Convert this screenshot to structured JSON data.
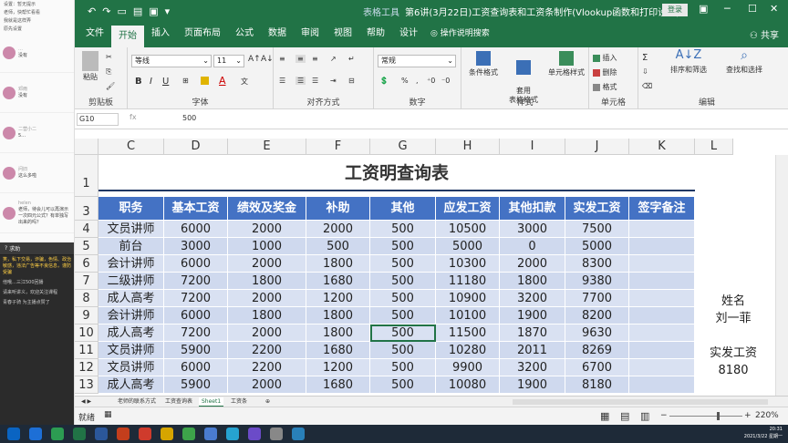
{
  "chat": {
    "top_lines": [
      "设置：暂无提示",
      "老师，快帮忙看看",
      "我就是这样弄",
      "原先设置"
    ],
    "rows": [
      {
        "name": "…",
        "text": "没有"
      },
      {
        "name": "邓雨",
        "text": "没有"
      },
      {
        "name": "二营小二",
        "text": "5…"
      },
      {
        "name": "问旧",
        "text": "这么多啦"
      },
      {
        "name": "helen",
        "text": "老师，待会儿可以再演示一次四元公式？有单独写出来的吗？"
      }
    ],
    "dark_title": "求助",
    "dark_messages": [
      {
        "text": "笑，私下交易，诈骗，色情、政治敏感，违法广告等不良信息，谨防受骗",
        "style": "y"
      },
      {
        "text": "他哦…三江500回播",
        "style": "w"
      },
      {
        "text": "请来听讲义，欢迎关注课程",
        "style": "w"
      },
      {
        "text": "青春子骑  为主播点赞了",
        "style": "w"
      }
    ]
  },
  "window": {
    "doc_title": "第6讲(3月22日)工资查询表和工资条制作(Vlookup函数和打印设置)...",
    "tool_label": "表格工具",
    "login_label": "登录",
    "share_label": "共享"
  },
  "tabs": [
    "文件",
    "开始",
    "插入",
    "页面布局",
    "公式",
    "数据",
    "审阅",
    "视图",
    "帮助",
    "设计"
  ],
  "active_tab": "开始",
  "tellme": "操作说明搜索",
  "ribbon": {
    "clipboard_label": "剪贴板",
    "paste_label": "粘贴",
    "font_name": "等线",
    "font_size": "11",
    "font_label": "字体",
    "align_label": "对齐方式",
    "number_format": "常规",
    "number_label": "数字",
    "style_items": [
      "条件格式",
      "套用\n表格格式",
      "单元格样式"
    ],
    "style_label": "样式",
    "cells_items": [
      "插入",
      "删除",
      "格式"
    ],
    "cells_label": "单元格",
    "edit_items": [
      "排序和筛选",
      "查找和选择"
    ],
    "edit_label": "编辑",
    "bold": "B",
    "italic": "I",
    "underline": "U"
  },
  "formula": {
    "namebox": "G10",
    "value": "500",
    "fx": "fx"
  },
  "columns": [
    "C",
    "D",
    "E",
    "F",
    "G",
    "H",
    "I",
    "J",
    "K",
    "L"
  ],
  "table": {
    "title": "工资明查询表",
    "headers": [
      "职务",
      "基本工资",
      "绩效及奖金",
      "补助",
      "其他",
      "应发工资",
      "其他扣款",
      "实发工资",
      "签字备注"
    ],
    "rows": [
      {
        "n": "4",
        "c": [
          "文员讲师",
          "6000",
          "2000",
          "2000",
          "500",
          "10500",
          "3000",
          "7500",
          ""
        ]
      },
      {
        "n": "5",
        "c": [
          "前台",
          "3000",
          "1000",
          "500",
          "500",
          "5000",
          "0",
          "5000",
          ""
        ]
      },
      {
        "n": "6",
        "c": [
          "会计讲师",
          "6000",
          "2000",
          "1800",
          "500",
          "10300",
          "2000",
          "8300",
          ""
        ]
      },
      {
        "n": "7",
        "c": [
          "二级讲师",
          "7200",
          "1800",
          "1680",
          "500",
          "11180",
          "1800",
          "9380",
          ""
        ]
      },
      {
        "n": "8",
        "c": [
          "成人高考",
          "7200",
          "2000",
          "1200",
          "500",
          "10900",
          "3200",
          "7700",
          ""
        ]
      },
      {
        "n": "9",
        "c": [
          "会计讲师",
          "6000",
          "1800",
          "1800",
          "500",
          "10100",
          "1900",
          "8200",
          ""
        ]
      },
      {
        "n": "10",
        "c": [
          "成人高考",
          "7200",
          "2000",
          "1800",
          "500",
          "11500",
          "1870",
          "9630",
          ""
        ]
      },
      {
        "n": "11",
        "c": [
          "文员讲师",
          "5900",
          "2200",
          "1680",
          "500",
          "10280",
          "2011",
          "8269",
          ""
        ]
      },
      {
        "n": "12",
        "c": [
          "文员讲师",
          "6000",
          "2200",
          "1200",
          "500",
          "9900",
          "3200",
          "6700",
          ""
        ]
      },
      {
        "n": "13",
        "c": [
          "成人高考",
          "5900",
          "2000",
          "1680",
          "500",
          "10080",
          "1900",
          "8180",
          ""
        ]
      }
    ],
    "row_title_num": "1",
    "row_header_num": "3"
  },
  "side": {
    "name_label": "姓名",
    "name_value": "刘一菲",
    "salary_label": "实发工资",
    "salary_value": "8180"
  },
  "sheet_tabs": [
    "老师的联系方式",
    "工资查询表",
    "Sheet1",
    "工资条"
  ],
  "active_sheet": "Sheet1",
  "status": {
    "mode": "就绪",
    "zoom": "220%"
  },
  "taskbar": {
    "time": "20:31",
    "date": "2021/3/22 星期一"
  }
}
